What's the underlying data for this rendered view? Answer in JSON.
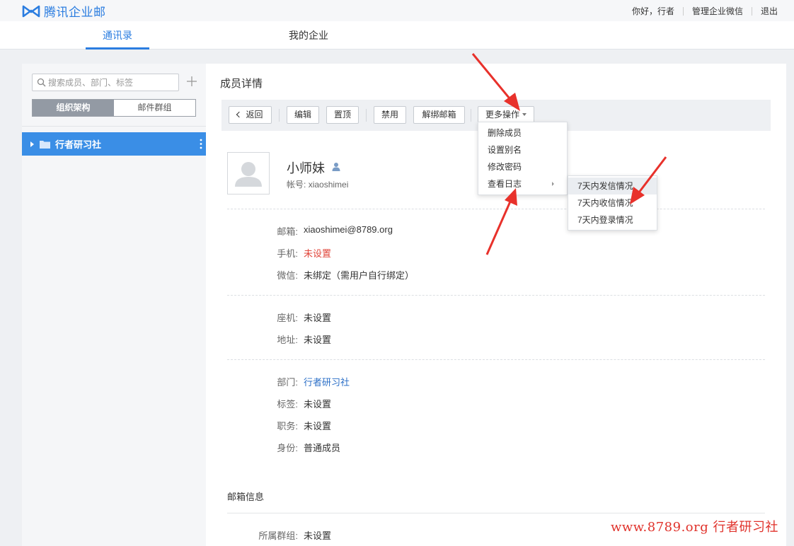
{
  "header": {
    "logo_text": "腾讯企业邮",
    "greeting": "你好，行者",
    "manage_wechat": "管理企业微信",
    "logout": "退出"
  },
  "nav": {
    "tabs": [
      "通讯录",
      "我的企业"
    ],
    "active": "通讯录"
  },
  "sidebar": {
    "search_placeholder": "搜索成员、部门、标签",
    "segments": [
      "组织架构",
      "邮件群组"
    ],
    "active_segment": "组织架构",
    "tree_items": [
      "行者研习社"
    ]
  },
  "panel": {
    "title": "成员详情",
    "toolbar": {
      "back": "返回",
      "edit": "编辑",
      "pin": "置顶",
      "disable": "禁用",
      "unbind": "解绑邮箱",
      "more": "更多操作"
    },
    "member": {
      "name": "小师妹",
      "account_label": "帐号:",
      "account": "xiaoshimei"
    },
    "fields": {
      "email": {
        "label": "邮箱:",
        "value": "xiaoshimei@8789.org"
      },
      "mobile": {
        "label": "手机:",
        "value": "未设置"
      },
      "wechat": {
        "label": "微信:",
        "value": "未绑定（需用户自行绑定）"
      },
      "phone": {
        "label": "座机:",
        "value": "未设置"
      },
      "address": {
        "label": "地址:",
        "value": "未设置"
      },
      "department": {
        "label": "部门:",
        "value": "行者研习社"
      },
      "tags": {
        "label": "标签:",
        "value": "未设置"
      },
      "position": {
        "label": "职务:",
        "value": "未设置"
      },
      "identity": {
        "label": "身份:",
        "value": "普通成员"
      }
    },
    "mailbox_section_title": "邮箱信息",
    "group": {
      "label": "所属群组:",
      "value": "未设置"
    }
  },
  "more_menu": {
    "items": [
      "删除成员",
      "设置别名",
      "修改密码",
      "查看日志"
    ],
    "submenu": [
      "7天内发信情况",
      "7天内收信情况",
      "7天内登录情况"
    ],
    "highlighted_submenu_item": "7天内发信情况"
  },
  "watermark": "www.8789.org 行者研习社",
  "colors": {
    "accent": "#2b7de0",
    "warning": "#e0453a",
    "annotation": "#e8312b"
  }
}
